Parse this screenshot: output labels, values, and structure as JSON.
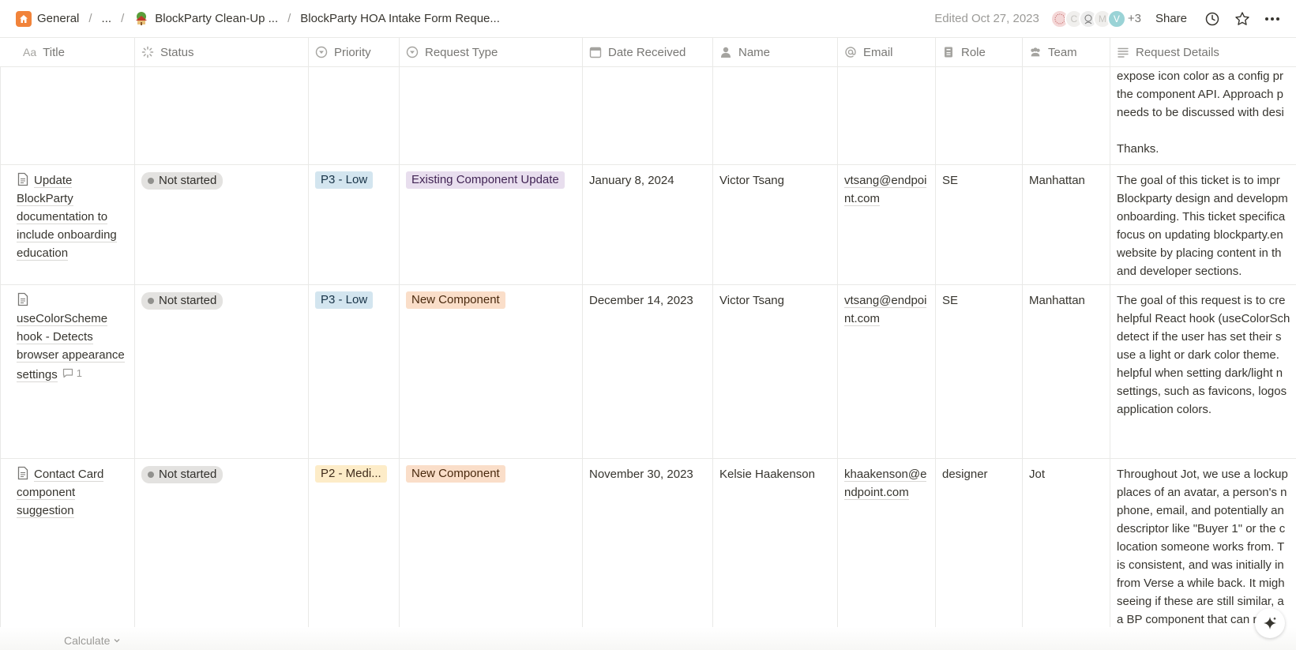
{
  "breadcrumb": {
    "items": [
      "General",
      "...",
      "BlockParty Clean-Up ...",
      "BlockParty HOA Intake Form Reque..."
    ],
    "separator": "/"
  },
  "header": {
    "edited": "Edited Oct 27, 2023",
    "avatars": [
      "",
      "C",
      "",
      "M",
      "V"
    ],
    "more_count": "+3",
    "share_label": "Share"
  },
  "columns": {
    "title": "Title",
    "title_prefix": "Aa",
    "status": "Status",
    "priority": "Priority",
    "request_type": "Request Type",
    "date_received": "Date Received",
    "name": "Name",
    "email": "Email",
    "role": "Role",
    "team": "Team",
    "request_details": "Request Details"
  },
  "partial_row": {
    "details_lines": [
      "expose icon color as a config pr",
      "the component API. Approach p",
      "needs to be discussed with desi",
      "",
      "Thanks."
    ]
  },
  "rows": [
    {
      "title": "Update BlockParty documentation to include onboarding education",
      "status": "Not started",
      "priority": "P3 - Low",
      "request_type": "Existing Component Update",
      "date_received": "January 8, 2024",
      "name": "Victor Tsang",
      "email": "vtsang@endpoint.com",
      "role": "SE",
      "team": "Manhattan",
      "details_lines": [
        "The goal of this ticket is to impr",
        "Blockparty design and developm",
        "onboarding. This ticket specifica",
        "focus on updating blockparty.en",
        "website by placing content in th",
        "and developer sections."
      ]
    },
    {
      "title": "useColorScheme hook - Detects browser appearance settings",
      "comments": "1",
      "status": "Not started",
      "priority": "P3 - Low",
      "request_type": "New Component",
      "date_received": "December 14, 2023",
      "name": "Victor Tsang",
      "email": "vtsang@endpoint.com",
      "role": "SE",
      "team": "Manhattan",
      "details_lines": [
        "The goal of this request is to cre",
        "helpful React hook (useColorSch",
        "detect if the user has set their s",
        "use a light or dark color theme.",
        "helpful when setting dark/light n",
        "settings, such as favicons, logos",
        "application colors."
      ]
    },
    {
      "title": "Contact Card component suggestion",
      "status": "Not started",
      "priority": "P2 - Medi...",
      "request_type": "New Component",
      "date_received": "November 30, 2023",
      "name": "Kelsie Haakenson",
      "email": "khaakenson@endpoint.com",
      "role": "designer",
      "team": "Jot",
      "details_lines": [
        "Throughout Jot, we use a lockup",
        "places of an avatar, a person's n",
        "phone, email, and potentially an",
        "descriptor like \"Buyer 1\" or the c",
        "location someone works from. T",
        "is consistent, and was initially in",
        "from Verse a while back. It migh",
        "seeing if these are still similar, a",
        "a BP component that can reu"
      ]
    }
  ],
  "footer": {
    "calculate_label": "Calculate"
  },
  "colors": {
    "priority_low_bg": "#d3e5ef",
    "priority_low_fg": "#183347",
    "priority_med_bg": "#fdecc8",
    "priority_med_fg": "#402c1b",
    "type_existing_bg": "#e8deee",
    "type_existing_fg": "#412454",
    "type_new_bg": "#fadec9",
    "type_new_fg": "#49290e"
  }
}
